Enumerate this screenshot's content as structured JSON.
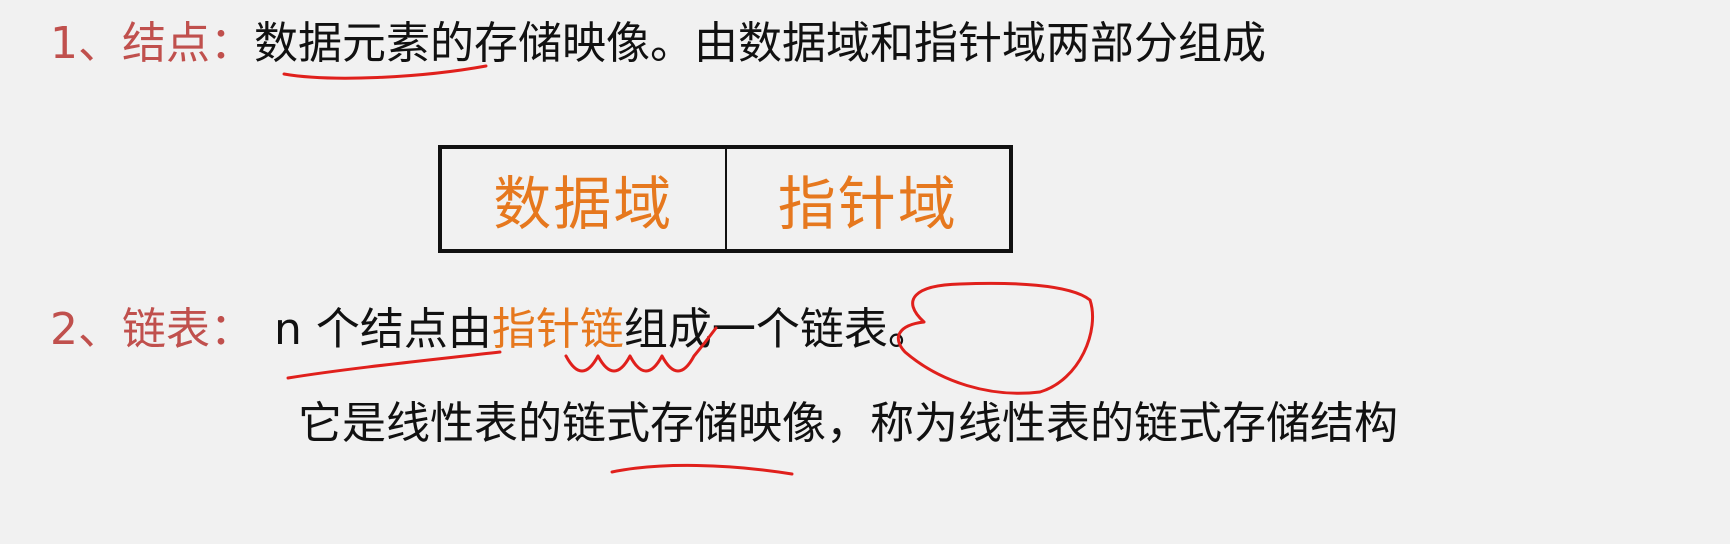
{
  "section1": {
    "label": "1、结点：",
    "definition": "数据元素的存储映像。由数据域和指针域两部分组成"
  },
  "node_diagram": {
    "data_field": "数据域",
    "pointer_field": "指针域"
  },
  "section2": {
    "label": "2、链表：",
    "text_before": "n 个结点由",
    "highlight": "指针链",
    "text_after": "组成一个链表。",
    "explanation": "它是线性表的链式存储映像，称为线性表的链式存储结构"
  },
  "colors": {
    "label": "#c0504d",
    "accent": "#e6781e",
    "text": "#111111",
    "annotation": "#e0201c",
    "background": "#f1f1f1"
  }
}
